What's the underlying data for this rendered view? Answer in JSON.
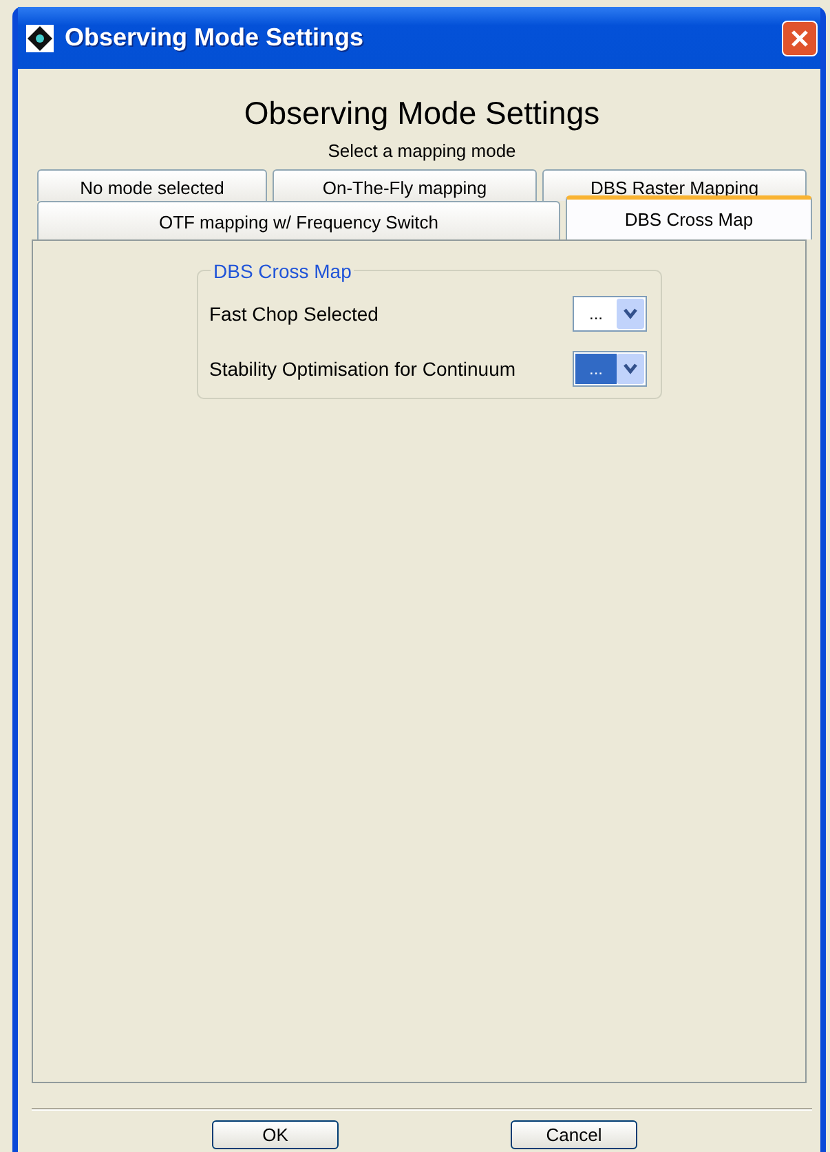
{
  "window": {
    "title": "Observing Mode Settings"
  },
  "heading": "Observing Mode Settings",
  "subtitle": "Select a mapping mode",
  "tab_rows": [
    [
      {
        "label": "No mode selected",
        "selected": false
      },
      {
        "label": "On-The-Fly mapping",
        "selected": false
      },
      {
        "label": "DBS Raster Mapping",
        "selected": false
      }
    ],
    [
      {
        "label": "OTF mapping w/ Frequency Switch",
        "selected": false
      },
      {
        "label": "DBS Cross Map",
        "selected": true
      }
    ]
  ],
  "group": {
    "title": "DBS Cross Map",
    "settings": [
      {
        "label": "Fast Chop Selected",
        "value": "...",
        "focused": false
      },
      {
        "label": "Stability Optimisation for Continuum",
        "value": "...",
        "focused": true
      }
    ]
  },
  "buttons": [
    "OK",
    "Cancel"
  ]
}
